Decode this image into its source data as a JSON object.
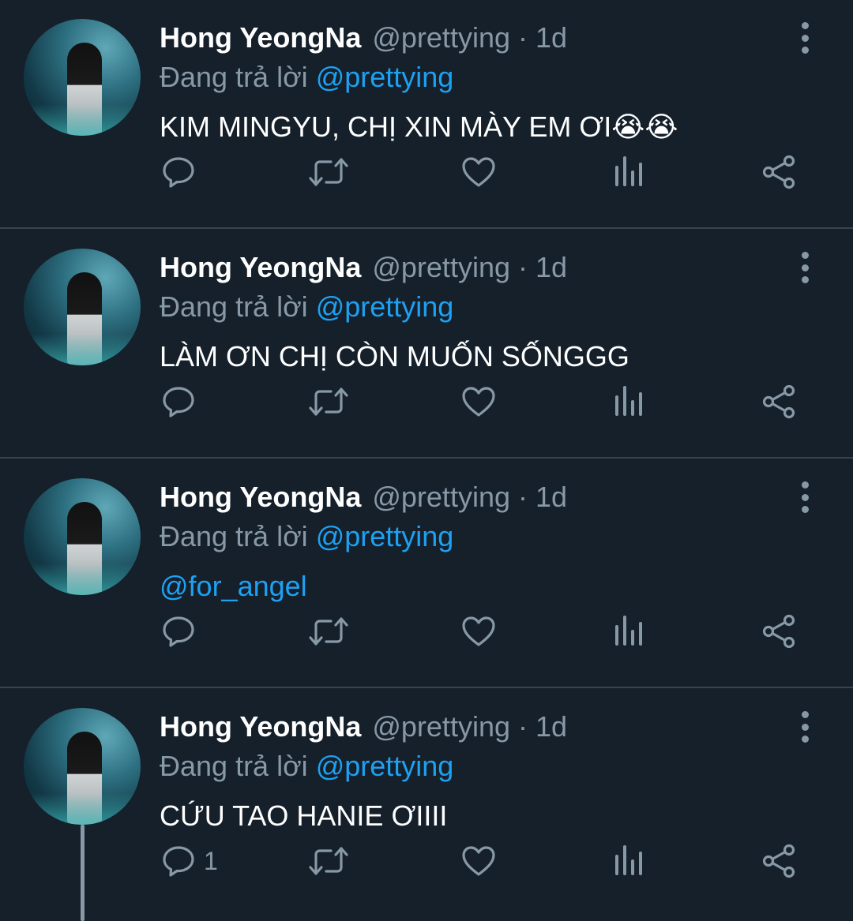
{
  "tweets": [
    {
      "display_name": "Hong YeongNa",
      "handle": "@prettying",
      "dot": "·",
      "time": "1d",
      "reply_prefix": "Đang trả lời",
      "reply_to": "@prettying",
      "text": "KIM MINGYU, CHỊ XIN MÀY EM ƠI😭😭",
      "reply_count": ""
    },
    {
      "display_name": "Hong YeongNa",
      "handle": "@prettying",
      "dot": "·",
      "time": "1d",
      "reply_prefix": "Đang trả lời",
      "reply_to": "@prettying",
      "text": "LÀM ƠN CHỊ CÒN MUỐN SỐNGGG",
      "reply_count": ""
    },
    {
      "display_name": "Hong YeongNa",
      "handle": "@prettying",
      "dot": "·",
      "time": "1d",
      "reply_prefix": "Đang trả lời",
      "reply_to": "@prettying",
      "text": "@for_angel",
      "reply_count": ""
    },
    {
      "display_name": "Hong YeongNa",
      "handle": "@prettying",
      "dot": "·",
      "time": "1d",
      "reply_prefix": "Đang trả lời",
      "reply_to": "@prettying",
      "text": "CỨU TAO HANIE ƠIIII",
      "reply_count": "1"
    }
  ],
  "icons": [
    "reply-icon",
    "retweet-icon",
    "like-icon",
    "analytics-icon",
    "share-icon",
    "more-icon"
  ],
  "colors": {
    "background": "#15202b",
    "divider": "#38444d",
    "muted": "#8899a6",
    "link": "#1da1f2",
    "text": "#ffffff"
  }
}
